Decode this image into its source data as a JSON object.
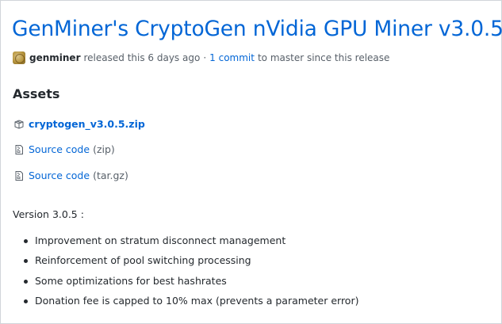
{
  "release": {
    "title": "GenMiner's CryptoGen nVidia GPU Miner v3.0.5",
    "author": "genminer",
    "released_text": "released this 6 days ago",
    "separator": "·",
    "commits_link": "1 commit",
    "commits_suffix": "to master since this release"
  },
  "assets": {
    "heading": "Assets",
    "items": [
      {
        "name": "cryptogen_v3.0.5.zip",
        "ext": "",
        "icon": "package-icon"
      },
      {
        "name": "Source code",
        "ext": "(zip)",
        "icon": "file-zip-icon"
      },
      {
        "name": "Source code",
        "ext": "(tar.gz)",
        "icon": "file-zip-icon"
      }
    ]
  },
  "notes": {
    "version_line": "Version 3.0.5 :",
    "items": [
      "Improvement on stratum disconnect management",
      "Reinforcement of pool switching processing",
      "Some optimizations for best hashrates",
      "Donation fee is capped to 10% max (prevents a parameter error)"
    ]
  },
  "colors": {
    "link": "#0366d6",
    "text": "#24292e",
    "muted": "#586069",
    "border": "#d1d5da"
  }
}
